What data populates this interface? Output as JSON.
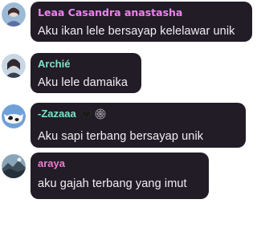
{
  "colors": {
    "bubble": "#221c26",
    "text": "#f2eef2",
    "author_pink": "#ee82ee",
    "author_teal": "#7fe3c9",
    "author_pink2": "#f07ccf"
  },
  "messages": [
    {
      "author": "Leaa Casandra anastasha",
      "text": "Aku ikan lele bersayap kelelawar unik",
      "avatar_icon": "profile-avatar-icon"
    },
    {
      "author": "Archié",
      "text": "Aku lele damaika",
      "avatar_icon": "profile-avatar-icon"
    },
    {
      "author": "-Zazaaa",
      "text": "Aku sapi terbang bersayap unik",
      "avatar_icon": "cow-avatar-icon",
      "badge_icons": [
        "heart-icon",
        "spiderweb-icon"
      ]
    },
    {
      "author": "araya",
      "text": "aku gajah terbang yang imut",
      "avatar_icon": "landscape-avatar-icon"
    }
  ]
}
